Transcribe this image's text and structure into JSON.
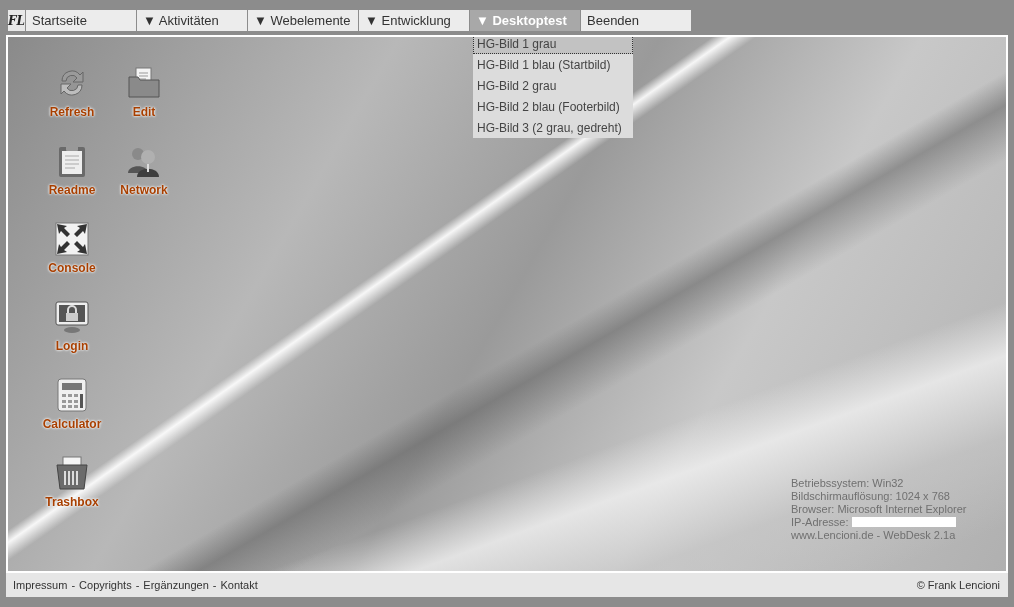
{
  "menu_bar": {
    "logo": "FL",
    "items": [
      {
        "label": "Startseite",
        "selected": false
      },
      {
        "label": "▼ Aktivitäten",
        "selected": false
      },
      {
        "label": "▼ Webelemente",
        "selected": false
      },
      {
        "label": "▼ Entwicklung",
        "selected": false
      },
      {
        "label": "▼ Desktoptest",
        "selected": true
      },
      {
        "label": "Beenden",
        "selected": false
      }
    ]
  },
  "dropdown": {
    "items": [
      {
        "label": "HG-Bild 1 grau",
        "selected": true
      },
      {
        "label": "HG-Bild 1 blau (Startbild)",
        "selected": false
      },
      {
        "label": "HG-Bild 2 grau",
        "selected": false
      },
      {
        "label": "HG-Bild 2 blau (Footerbild)",
        "selected": false
      },
      {
        "label": "HG-Bild 3 (2 grau, gedreht)",
        "selected": false
      }
    ]
  },
  "desktop_icons": [
    {
      "kind": "refresh",
      "label": "Refresh"
    },
    {
      "kind": "folder",
      "label": "Edit"
    },
    {
      "kind": "clipboard",
      "label": "Readme"
    },
    {
      "kind": "users",
      "label": "Network"
    },
    {
      "kind": "expand",
      "label": "Console"
    },
    {
      "kind": "lock",
      "label": "Login"
    },
    {
      "kind": "calculator",
      "label": "Calculator"
    },
    {
      "kind": "trash",
      "label": "Trashbox"
    }
  ],
  "system_info": [
    {
      "kind": "text",
      "text": "Betriebssystem: Win32"
    },
    {
      "kind": "text",
      "text": "Bildschirmauflösung: 1024 x 768"
    },
    {
      "kind": "text",
      "text": "Browser: Microsoft Internet Explorer"
    },
    {
      "kind": "redacted",
      "text": "IP-Adresse:"
    },
    {
      "kind": "text",
      "text": "www.Lencioni.de - WebDesk 2.1a"
    }
  ],
  "footer": {
    "links": [
      "Impressum",
      "Copyrights",
      "Ergänzungen",
      "Kontakt"
    ],
    "separator": "-",
    "copyright": "© Frank Lencioni"
  }
}
